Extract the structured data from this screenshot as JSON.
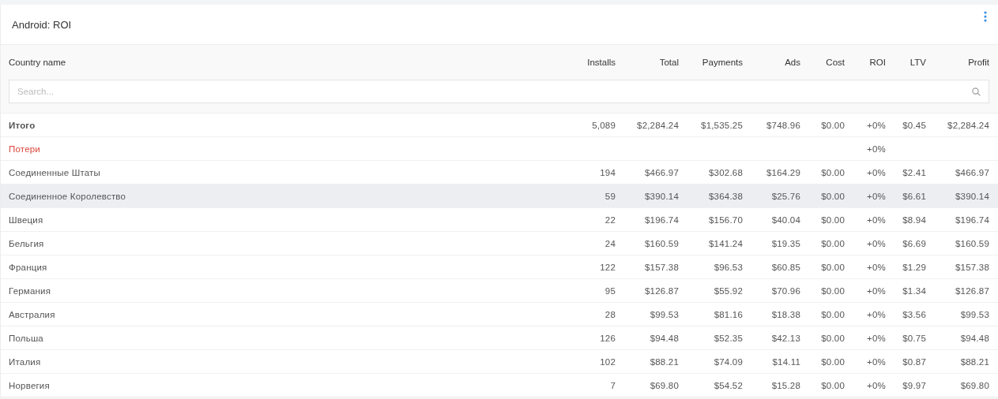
{
  "card": {
    "title": "Android: ROI"
  },
  "table": {
    "columns": [
      "Country name",
      "Installs",
      "Total",
      "Payments",
      "Ads",
      "Cost",
      "ROI",
      "LTV",
      "Profit"
    ],
    "search": {
      "placeholder": "Search..."
    },
    "rows": [
      {
        "kind": "total",
        "highlighted": false,
        "cells": [
          "Итого",
          "5,089",
          "$2,284.24",
          "$1,535.25",
          "$748.96",
          "$0.00",
          "+0%",
          "$0.45",
          "$2,284.24"
        ]
      },
      {
        "kind": "loss",
        "highlighted": false,
        "cells": [
          "Потери",
          null,
          null,
          null,
          null,
          null,
          "+0%",
          null,
          null
        ]
      },
      {
        "kind": "country",
        "highlighted": false,
        "cells": [
          "Соединенные Штаты",
          "194",
          "$466.97",
          "$302.68",
          "$164.29",
          "$0.00",
          "+0%",
          "$2.41",
          "$466.97"
        ]
      },
      {
        "kind": "country",
        "highlighted": true,
        "cells": [
          "Соединенное Королевство",
          "59",
          "$390.14",
          "$364.38",
          "$25.76",
          "$0.00",
          "+0%",
          "$6.61",
          "$390.14"
        ]
      },
      {
        "kind": "country",
        "highlighted": false,
        "cells": [
          "Швеция",
          "22",
          "$196.74",
          "$156.70",
          "$40.04",
          "$0.00",
          "+0%",
          "$8.94",
          "$196.74"
        ]
      },
      {
        "kind": "country",
        "highlighted": false,
        "cells": [
          "Бельгия",
          "24",
          "$160.59",
          "$141.24",
          "$19.35",
          "$0.00",
          "+0%",
          "$6.69",
          "$160.59"
        ]
      },
      {
        "kind": "country",
        "highlighted": false,
        "cells": [
          "Франция",
          "122",
          "$157.38",
          "$96.53",
          "$60.85",
          "$0.00",
          "+0%",
          "$1.29",
          "$157.38"
        ]
      },
      {
        "kind": "country",
        "highlighted": false,
        "cells": [
          "Германия",
          "95",
          "$126.87",
          "$55.92",
          "$70.96",
          "$0.00",
          "+0%",
          "$1.34",
          "$126.87"
        ]
      },
      {
        "kind": "country",
        "highlighted": false,
        "cells": [
          "Австралия",
          "28",
          "$99.53",
          "$81.16",
          "$18.38",
          "$0.00",
          "+0%",
          "$3.56",
          "$99.53"
        ]
      },
      {
        "kind": "country",
        "highlighted": false,
        "cells": [
          "Польша",
          "126",
          "$94.48",
          "$52.35",
          "$42.13",
          "$0.00",
          "+0%",
          "$0.75",
          "$94.48"
        ]
      },
      {
        "kind": "country",
        "highlighted": false,
        "cells": [
          "Италия",
          "102",
          "$88.21",
          "$74.09",
          "$14.11",
          "$0.00",
          "+0%",
          "$0.87",
          "$88.21"
        ]
      },
      {
        "kind": "country",
        "highlighted": false,
        "cells": [
          "Норвегия",
          "7",
          "$69.80",
          "$54.52",
          "$15.28",
          "$0.00",
          "+0%",
          "$9.97",
          "$69.80"
        ]
      }
    ]
  }
}
